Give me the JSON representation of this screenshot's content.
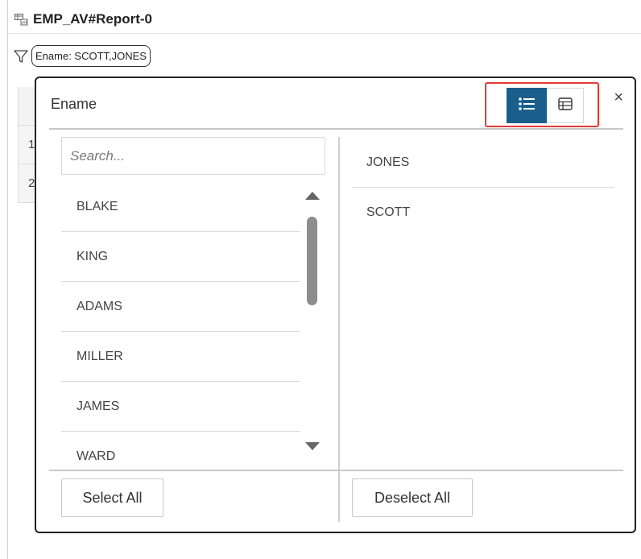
{
  "header": {
    "report_title": "EMP_AV#Report-0",
    "icon": "report-icon"
  },
  "filter": {
    "icon": "funnel-icon",
    "chip_label": "Ename: SCOTT,JONES"
  },
  "background_table": {
    "row_numbers": [
      "1",
      "2"
    ]
  },
  "popup": {
    "title": "Ename",
    "view_toggle": {
      "list_view_icon": "list-view-icon",
      "grid_view_icon": "grid-view-icon",
      "active": "list",
      "active_color": "#1a5f8c"
    },
    "highlight_color": "#e53935",
    "close_label": "×",
    "search": {
      "placeholder": "Search...",
      "value": ""
    },
    "available_items": [
      "BLAKE",
      "KING",
      "ADAMS",
      "MILLER",
      "JAMES",
      "WARD"
    ],
    "selected_items": [
      "JONES",
      "SCOTT"
    ],
    "select_all_label": "Select All",
    "deselect_all_label": "Deselect All"
  }
}
